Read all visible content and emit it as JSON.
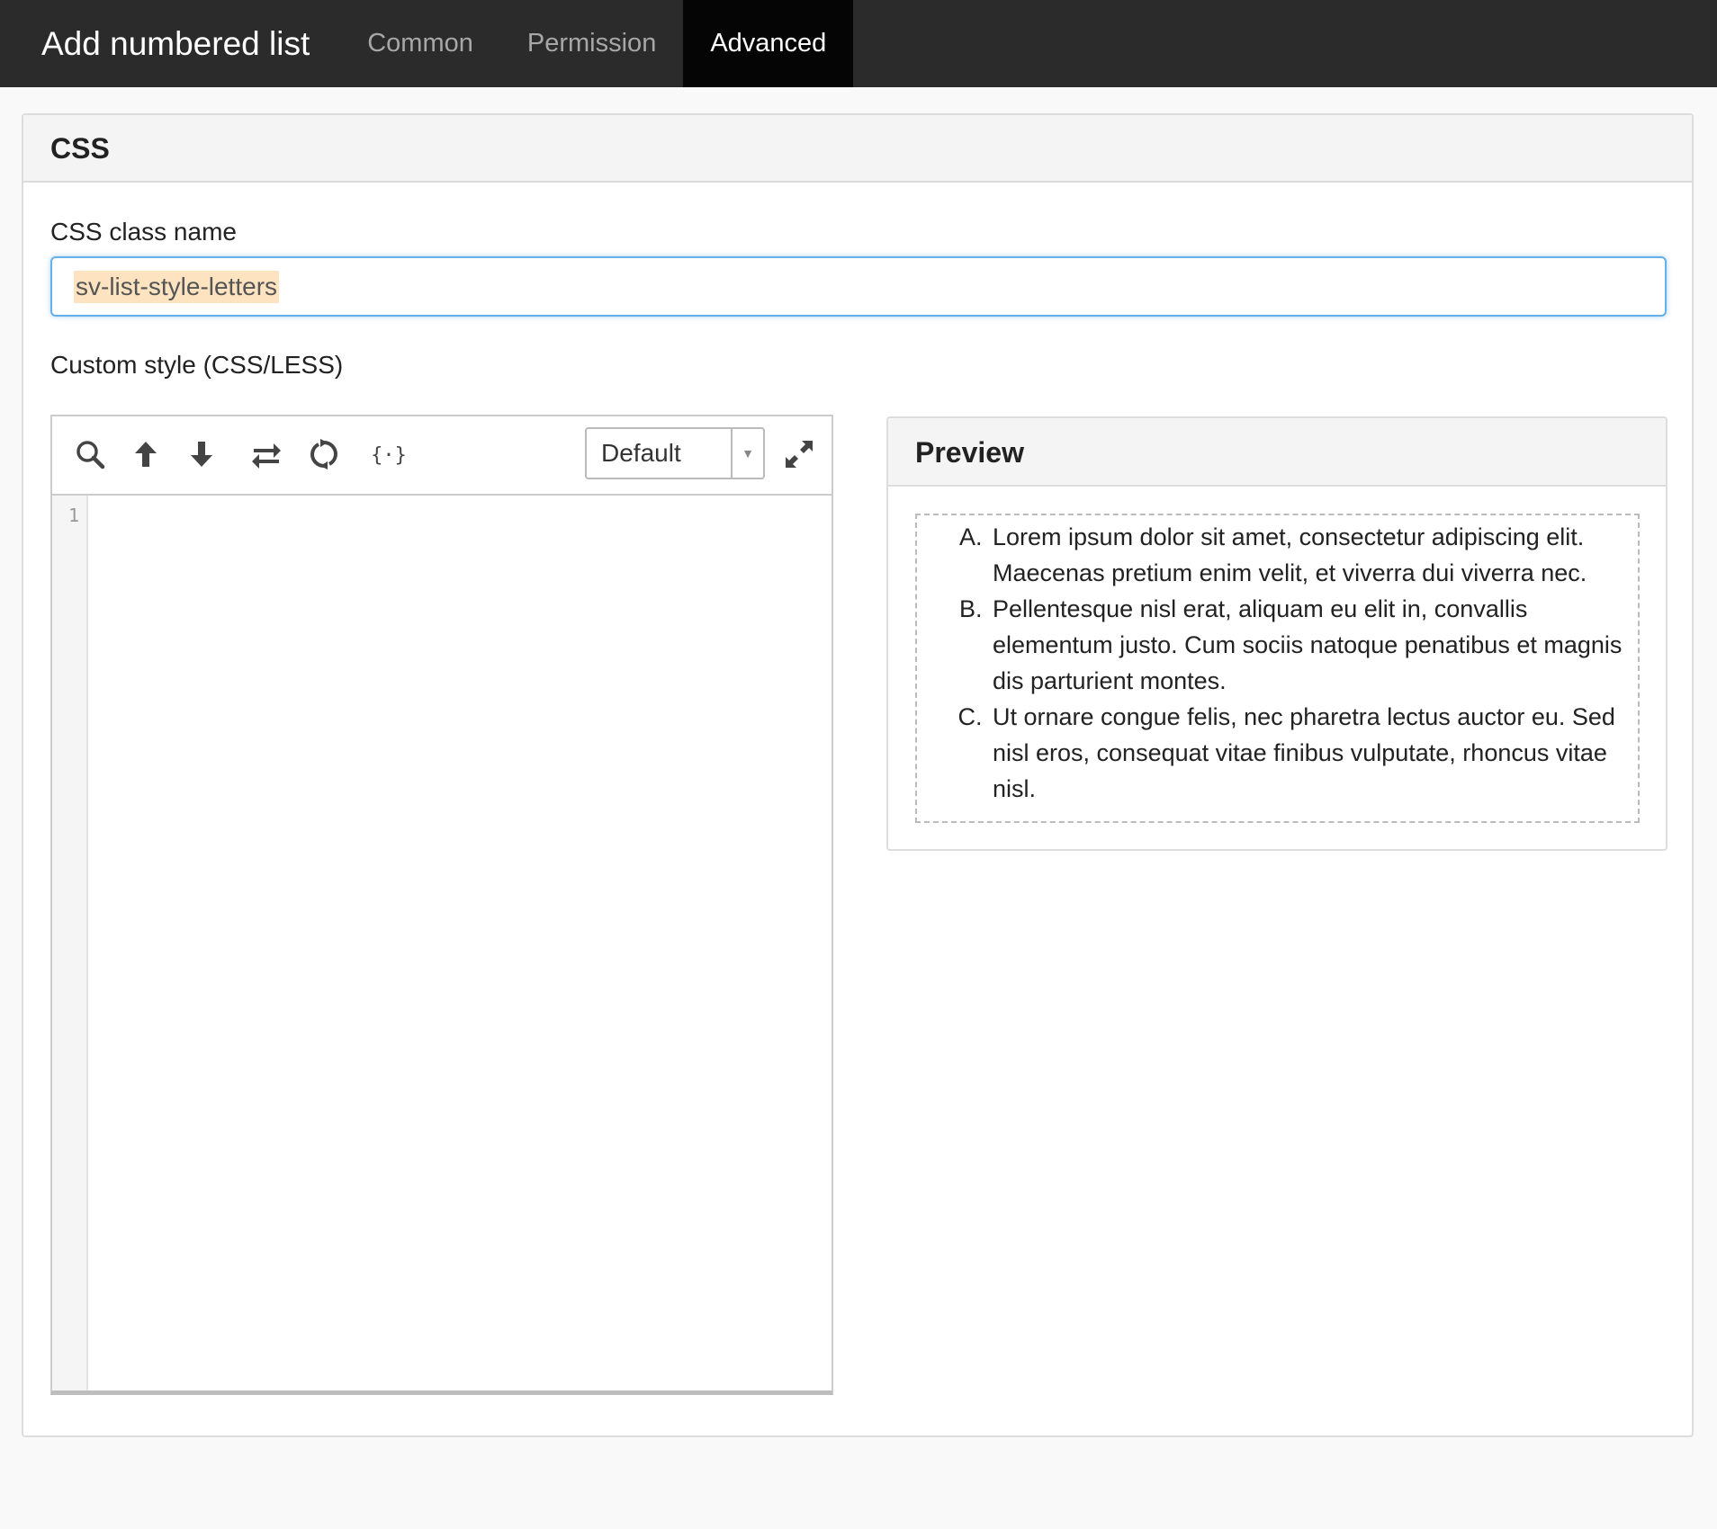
{
  "header": {
    "title": "Add numbered list",
    "tabs": [
      {
        "label": "Common",
        "active": false
      },
      {
        "label": "Permission",
        "active": false
      },
      {
        "label": "Advanced",
        "active": true
      }
    ]
  },
  "panel": {
    "title": "CSS",
    "class_name_label": "CSS class name",
    "class_name_value": "sv-list-style-letters",
    "custom_style_label": "Custom style (CSS/LESS)"
  },
  "editor": {
    "toolbar_icons": [
      "search-icon",
      "arrow-up-icon",
      "arrow-down-icon",
      "swap-icon",
      "refresh-icon",
      "braces-icon"
    ],
    "mode": "Default",
    "line_numbers": [
      "1"
    ]
  },
  "preview": {
    "title": "Preview",
    "items": [
      "Lorem ipsum dolor sit amet, consectetur adipiscing elit. Maecenas pretium enim velit, et viverra dui viverra nec.",
      "Pellentesque nisl erat, aliquam eu elit in, convallis elementum justo. Cum sociis natoque penatibus et magnis dis parturient montes.",
      "Ut ornare congue felis, nec pharetra lectus auctor eu. Sed nisl eros, consequat vitae finibus vulputate, rhoncus vitae nisl."
    ]
  },
  "colors": {
    "topbar": "#2b2b2b",
    "active_tab": "#050505",
    "focus_border": "#66afe9",
    "highlight": "#fde3bf"
  }
}
